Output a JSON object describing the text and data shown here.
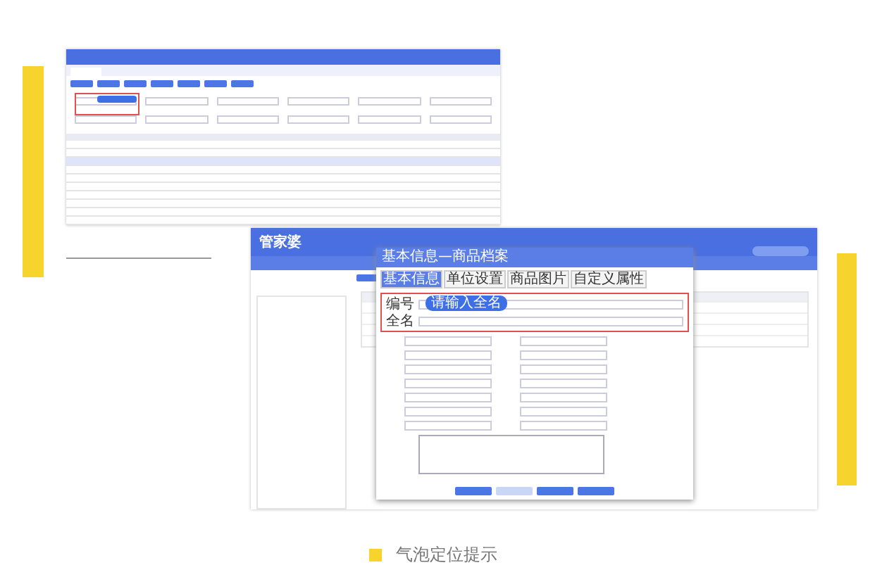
{
  "caption": "气泡定位提示",
  "screenshot_1": {
    "table_rows": [
      {
        "selected": false
      },
      {
        "selected": false
      },
      {
        "selected": true
      },
      {
        "selected": false
      },
      {
        "selected": false
      },
      {
        "selected": false
      },
      {
        "selected": false
      },
      {
        "selected": false
      },
      {
        "selected": false
      },
      {
        "selected": false
      }
    ]
  },
  "screenshot_2": {
    "logo": "管家婆",
    "dialog": {
      "title": "基本信息—商品档案",
      "tabs": [
        {
          "label": "基本信息",
          "selected": true
        },
        {
          "label": "单位设置",
          "selected": false
        },
        {
          "label": "商品图片",
          "selected": false
        },
        {
          "label": "自定义属性",
          "selected": false
        }
      ],
      "required_fields": [
        {
          "label": "编号",
          "tooltip": "请输入全名"
        },
        {
          "label": "全名"
        }
      ]
    }
  }
}
